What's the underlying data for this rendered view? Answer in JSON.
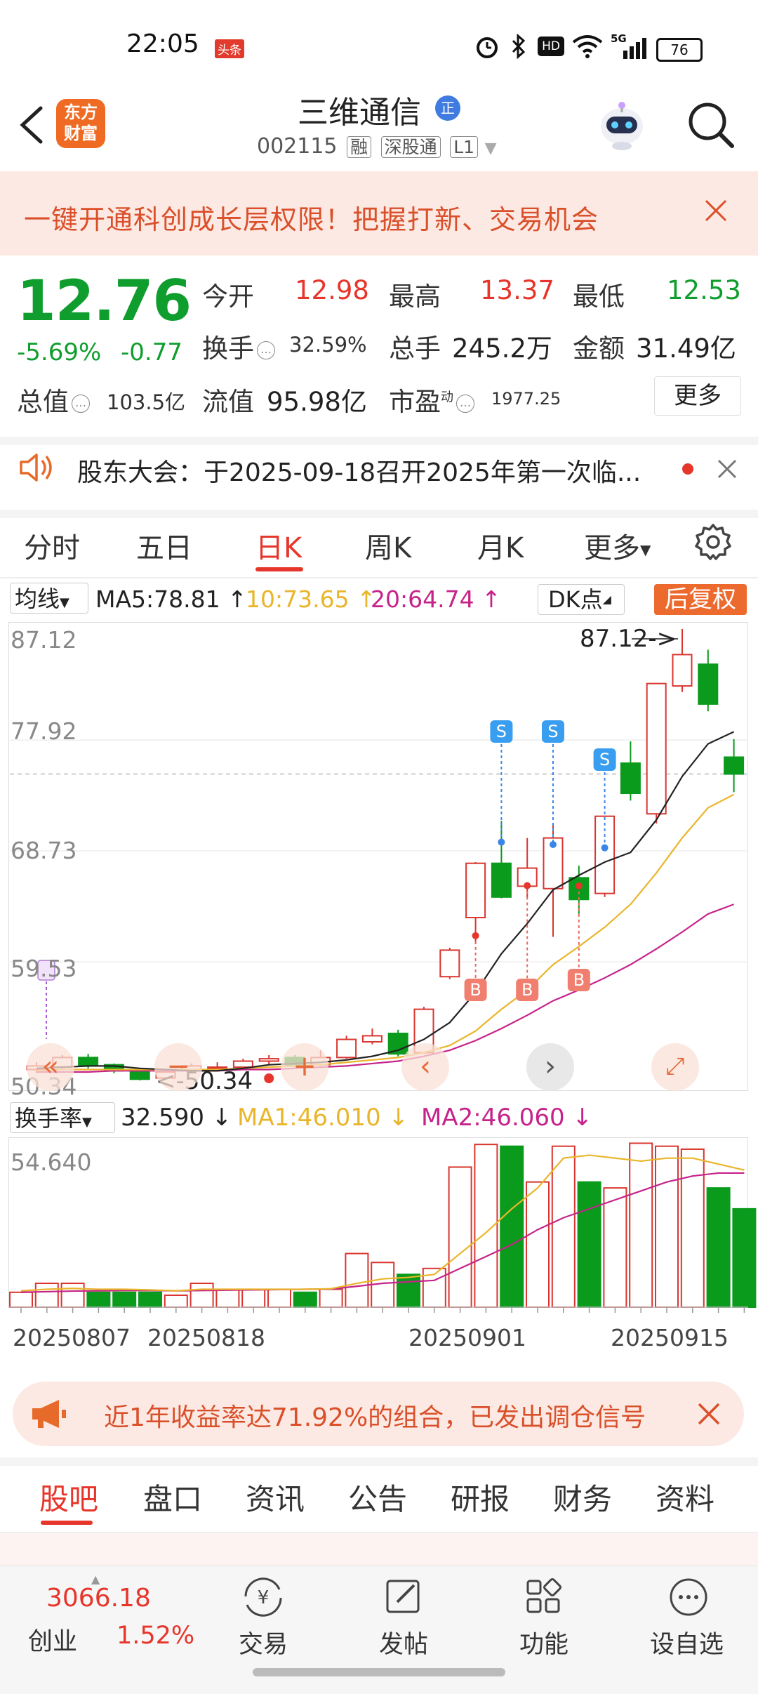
{
  "status": {
    "time": "22:05",
    "badge": "头条",
    "battery": "76",
    "signal_label": "5G",
    "hd": "HD"
  },
  "header": {
    "name": "三维通信",
    "name_badge": "正",
    "code": "002115",
    "tags": [
      "融",
      "深股通",
      "L1"
    ],
    "logo": [
      "东方",
      "财富"
    ]
  },
  "banner": {
    "text": "一键开通科创成长层权限！把握打新、交易机会"
  },
  "quote": {
    "price": "12.76",
    "change_pct": "-5.69%",
    "change_abs": "-0.77",
    "open_label": "今开",
    "open": "12.98",
    "high_label": "最高",
    "high": "13.37",
    "low_label": "最低",
    "low": "12.53",
    "turnover_label": "换手",
    "turnover": "32.59%",
    "volume_label": "总手",
    "volume": "245.2万",
    "amount_label": "金额",
    "amount": "31.49亿",
    "mktcap_label": "总值",
    "mktcap": "103.5亿",
    "float_label": "流值",
    "float_cap": "95.98亿",
    "pe_label": "市盈",
    "pe_sup": "动",
    "pe": "1977.25",
    "more_label": "更多"
  },
  "announcement": {
    "text": "股东大会：于2025-09-18召开2025年第一次临..."
  },
  "chart_tabs": {
    "items": [
      "分时",
      "五日",
      "日K",
      "周K",
      "月K",
      "更多"
    ],
    "active": "日K"
  },
  "ma_legend": {
    "selector": "均线",
    "ma5": "MA5:78.81",
    "ma10": "10:73.65",
    "ma20": "20:64.74",
    "dk_label": "DK点",
    "adjust_label": "后复权",
    "colors": {
      "ma5": "#222222",
      "ma10": "#e9b52a",
      "ma20": "#c6238a",
      "up": "#d9362f",
      "down": "#0a9a1c"
    }
  },
  "volume_legend": {
    "selector": "换手率",
    "value": "32.590",
    "ma1": "MA1:46.010",
    "ma2": "MA2:46.060"
  },
  "chart_data": [
    {
      "type": "candlestick",
      "y_ticks": [
        "87.12",
        "77.92",
        "68.73",
        "59.53",
        "50.34"
      ],
      "ylim": [
        50.34,
        87.12
      ],
      "x_tick_labels": [
        "20250807",
        "20250818",
        "20250901",
        "20250915"
      ],
      "annotations": {
        "max_label": "87.12->",
        "min_label": "<-50.34",
        "signals": [
          "S",
          "S",
          "S",
          "B",
          "B",
          "B"
        ]
      },
      "candles": [
        {
          "o": 50.6,
          "c": 50.9,
          "h": 51.2,
          "l": 50.3
        },
        {
          "o": 50.8,
          "c": 51.6,
          "h": 51.8,
          "l": 50.6
        },
        {
          "o": 51.6,
          "c": 50.9,
          "h": 51.9,
          "l": 50.7
        },
        {
          "o": 51.0,
          "c": 50.5,
          "h": 51.1,
          "l": 50.3
        },
        {
          "o": 50.6,
          "c": 49.8,
          "h": 50.7,
          "l": 49.7
        },
        {
          "o": 49.9,
          "c": 50.4,
          "h": 50.6,
          "l": 49.8
        },
        {
          "o": 50.5,
          "c": 50.9,
          "h": 51.1,
          "l": 50.3
        },
        {
          "o": 50.8,
          "c": 50.8,
          "h": 51.2,
          "l": 50.6
        },
        {
          "o": 50.8,
          "c": 51.3,
          "h": 51.5,
          "l": 50.7
        },
        {
          "o": 51.3,
          "c": 51.5,
          "h": 51.8,
          "l": 51.0
        },
        {
          "o": 51.6,
          "c": 51.0,
          "h": 51.8,
          "l": 50.9
        },
        {
          "o": 51.0,
          "c": 51.6,
          "h": 52.2,
          "l": 50.9
        },
        {
          "o": 51.6,
          "c": 53.1,
          "h": 53.4,
          "l": 51.5
        },
        {
          "o": 52.9,
          "c": 53.4,
          "h": 54.0,
          "l": 52.7
        },
        {
          "o": 53.6,
          "c": 51.9,
          "h": 53.9,
          "l": 51.7
        },
        {
          "o": 52.0,
          "c": 55.6,
          "h": 55.8,
          "l": 51.9
        },
        {
          "o": 58.3,
          "c": 60.5,
          "h": 60.7,
          "l": 58.1
        },
        {
          "o": 63.2,
          "c": 67.7,
          "h": 67.8,
          "l": 61.0
        },
        {
          "o": 67.7,
          "c": 64.9,
          "h": 71.2,
          "l": 64.8
        },
        {
          "o": 65.8,
          "c": 67.3,
          "h": 69.8,
          "l": 64.8
        },
        {
          "o": 65.6,
          "c": 69.8,
          "h": 71.0,
          "l": 61.6
        },
        {
          "o": 66.5,
          "c": 64.7,
          "h": 67.5,
          "l": 63.5
        },
        {
          "o": 65.2,
          "c": 71.6,
          "h": 71.6,
          "l": 64.9
        },
        {
          "o": 76.0,
          "c": 73.5,
          "h": 77.8,
          "l": 72.9
        },
        {
          "o": 71.8,
          "c": 82.6,
          "h": 82.6,
          "l": 71.0
        },
        {
          "o": 82.4,
          "c": 85.0,
          "h": 87.12,
          "l": 81.9
        },
        {
          "o": 84.2,
          "c": 80.9,
          "h": 85.4,
          "l": 80.3
        },
        {
          "o": 76.5,
          "c": 75.1,
          "h": 78.0,
          "l": 73.6
        }
      ],
      "ma5": [
        50.7,
        50.8,
        50.9,
        50.9,
        50.7,
        50.6,
        50.5,
        50.5,
        50.7,
        51.0,
        51.1,
        51.2,
        51.4,
        51.7,
        52.2,
        53.1,
        54.5,
        57.0,
        60.2,
        62.7,
        65.5,
        66.7,
        67.8,
        68.6,
        71.3,
        74.9,
        77.6,
        78.6
      ],
      "ma10": [
        50.5,
        50.6,
        50.6,
        50.6,
        50.6,
        50.6,
        50.6,
        50.6,
        50.7,
        50.8,
        50.9,
        51.0,
        51.2,
        51.4,
        51.6,
        52.0,
        52.6,
        53.8,
        55.6,
        57.2,
        59.3,
        60.8,
        62.4,
        64.3,
        66.9,
        69.8,
        72.3,
        73.4
      ],
      "ma20": [
        50.4,
        50.4,
        50.4,
        50.5,
        50.5,
        50.5,
        50.5,
        50.5,
        50.6,
        50.6,
        50.7,
        50.8,
        50.9,
        51.1,
        51.3,
        51.7,
        52.2,
        53.0,
        54.0,
        55.1,
        56.3,
        57.2,
        58.2,
        59.3,
        60.6,
        62.0,
        63.5,
        64.3
      ]
    },
    {
      "type": "bar",
      "title": "换手率",
      "y_ticks": [
        "54.640"
      ],
      "ylim": [
        0,
        54.64
      ],
      "values": [
        5,
        8,
        8,
        5,
        5,
        5,
        4,
        8,
        6,
        6,
        6,
        5,
        6,
        18,
        15,
        11,
        13,
        47,
        54.6,
        54,
        42,
        54,
        42,
        40,
        55,
        54,
        53,
        40,
        33
      ],
      "up": [
        true,
        true,
        true,
        false,
        false,
        false,
        true,
        true,
        true,
        true,
        true,
        false,
        true,
        true,
        true,
        false,
        true,
        true,
        true,
        false,
        true,
        true,
        false,
        true,
        true,
        true,
        true,
        false,
        false
      ],
      "ma1": [
        5.5,
        6,
        6.3,
        6,
        6,
        5.8,
        5.5,
        6,
        6,
        6,
        6,
        6,
        6.2,
        8,
        9.5,
        10,
        11,
        18,
        25,
        33,
        40,
        50,
        51,
        50,
        49,
        50,
        50,
        48,
        46
      ],
      "ma2": [
        5,
        5.2,
        5.4,
        5.5,
        5.6,
        5.6,
        5.5,
        5.6,
        5.7,
        5.8,
        5.9,
        6,
        6.1,
        7,
        8,
        8.5,
        9,
        13,
        17,
        21,
        26,
        30,
        33,
        36,
        39,
        42,
        44,
        45,
        45
      ]
    }
  ],
  "promo": {
    "text": "近1年收益率达71.92%的组合，已发出调仓信号"
  },
  "bottom_tabs": {
    "items": [
      "股吧",
      "盘口",
      "资讯",
      "公告",
      "研报",
      "财务",
      "资料"
    ],
    "active": "股吧"
  },
  "bottom_nav": {
    "index_value": "3066.18",
    "index_name": "创业",
    "index_change": "1.52%",
    "items": [
      "交易",
      "发帖",
      "功能",
      "设自选"
    ]
  }
}
